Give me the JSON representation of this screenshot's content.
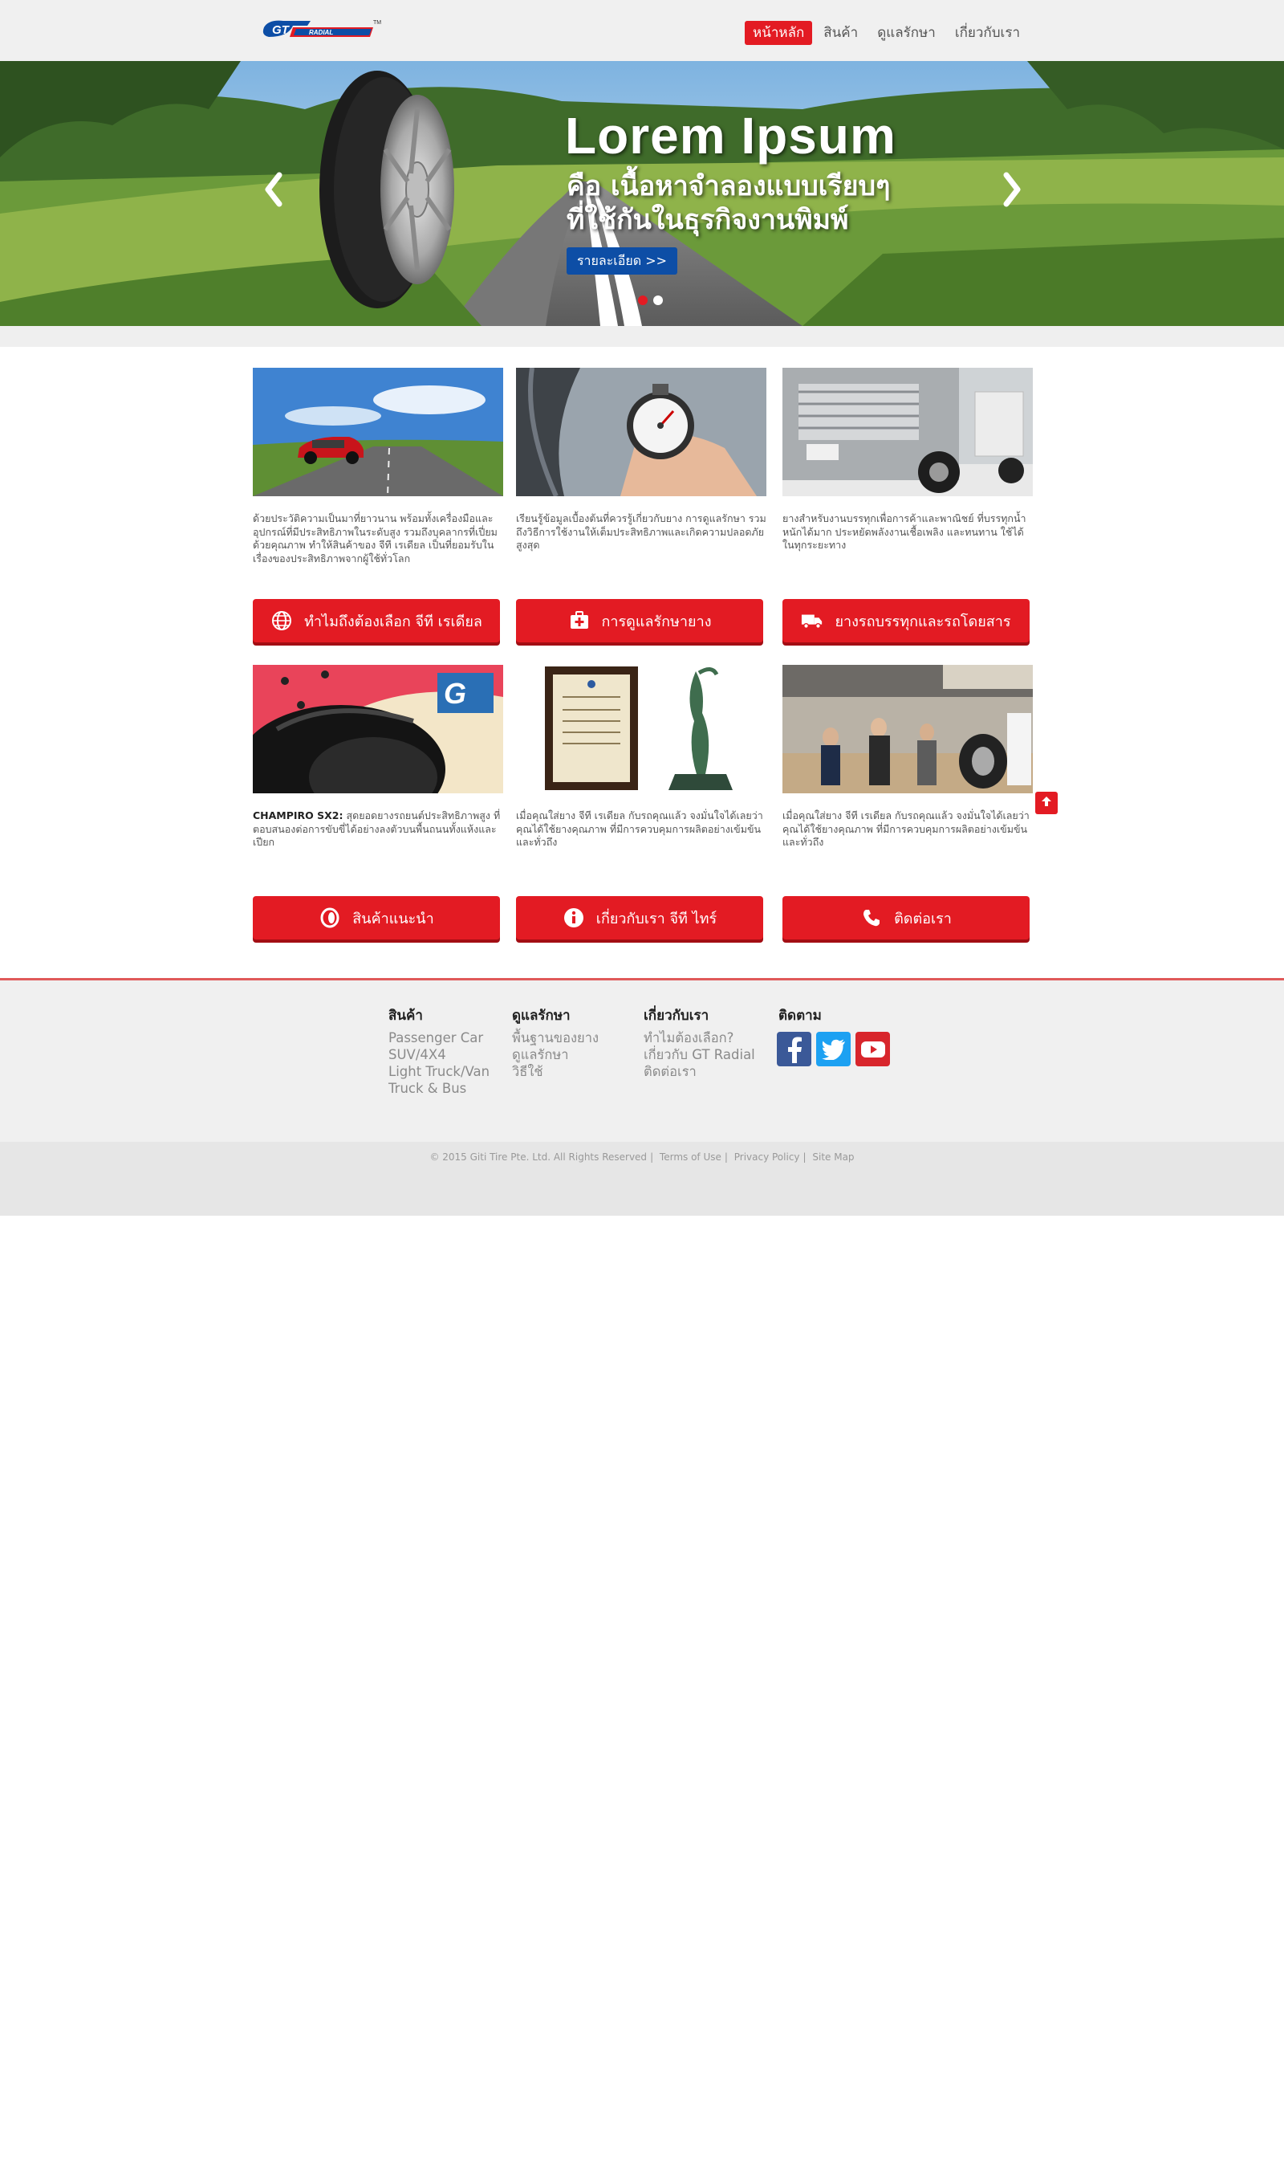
{
  "nav": [
    {
      "label": "หน้าหลัก",
      "active": true
    },
    {
      "label": "สินค้า"
    },
    {
      "label": "ดูแลรักษา"
    },
    {
      "label": "เกี่ยวกับเรา"
    }
  ],
  "hero": {
    "title": "Lorem Ipsum",
    "subtitle_line1": "คือ เนื้อหาจำลองแบบเรียบๆ",
    "subtitle_line2": "ที่ใช้กันในธุรกิจงานพิมพ์",
    "button": "รายละเอียด >>",
    "active_slide": 2,
    "slide_count": 3
  },
  "cards": [
    {
      "text": "ด้วยประวัติความเป็นมาที่ยาวนาน พร้อมทั้งเครื่องมือและอุปกรณ์ที่มีประสิทธิภาพในระดับสูง รวมถึงบุคลากรที่เปี่ยมด้วยคุณภาพ ทำให้สินค้าของ จีที เรเดียล เป็นที่ยอมรับในเรื่องของประสิทธิภาพจากผู้ใช้ทั่วโลก",
      "button": "ทำไมถึงต้องเลือก จีที เรเดียล",
      "icon": "globe-icon"
    },
    {
      "text": "เรียนรู้ข้อมูลเบื้องต้นที่ควรรู้เกี่ยวกับยาง การดูแลรักษา รวมถึงวิธีการใช้งานให้เต็มประสิทธิภาพและเกิดความปลอดภัยสูงสุด",
      "button": "การดูแลรักษายาง",
      "icon": "first-aid-icon"
    },
    {
      "text": "ยางสำหรับงานบรรทุกเพื่อการค้าและพาณิชย์ ที่บรรทุกน้ำหนักได้มาก ประหยัดพลังงานเชื้อเพลิง และทนทาน ใช้ได้ในทุกระยะทาง",
      "button": "ยางรถบรรทุกและรถโดยสาร",
      "icon": "truck-icon"
    },
    {
      "text_bold": "CHAMPIRO SX2:",
      "text": " สุดยอดยางรถยนต์ประสิทธิภาพสูง ที่ตอบสนองต่อการขับขี่ได้อย่างลงตัวบนพื้นถนนทั้งแห้งและเปียก",
      "button": "สินค้าแนะนำ",
      "icon": "tire-icon"
    },
    {
      "text": "เมื่อคุณใส่ยาง จีที เรเดียล กับรถคุณแล้ว จงมั่นใจได้เลยว่าคุณได้ใช้ยางคุณภาพ ที่มีการควบคุมการผลิตอย่างเข้มข้น และทั่วถึง",
      "button": "เกี่ยวกับเรา จีที ไทร์",
      "icon": "info-icon"
    },
    {
      "text": "เมื่อคุณใส่ยาง จีที เรเดียล กับรถคุณแล้ว จงมั่นใจได้เลยว่าคุณได้ใช้ยางคุณภาพ ที่มีการควบคุมการผลิตอย่างเข้มข้น และทั่วถึง",
      "button": "ติดต่อเรา",
      "icon": "phone-icon"
    }
  ],
  "footer": {
    "products": {
      "title": "สินค้า",
      "links": [
        "Passenger Car",
        "SUV/4X4",
        "Light Truck/Van",
        "Truck & Bus"
      ]
    },
    "care": {
      "title": "ดูแลรักษา",
      "links": [
        "พื้นฐานของยาง",
        "ดูแลรักษา",
        "วิธีใช้"
      ]
    },
    "about": {
      "title": "เกี่ยวกับเรา",
      "links": [
        "ทำไมต้องเลือก?",
        "เกี่ยวกับ GT Radial",
        "ติดต่อเรา"
      ]
    },
    "follow": {
      "title": "ติดตาม"
    }
  },
  "copyright": {
    "text": "© 2015 Giti Tire Pte. Ltd. All Rights Reserved",
    "terms": "Terms of Use",
    "privacy": "Privacy Policy",
    "sitemap": "Site Map"
  },
  "colors": {
    "brand_red": "#e31b23",
    "brand_blue": "#0d4ea6"
  }
}
